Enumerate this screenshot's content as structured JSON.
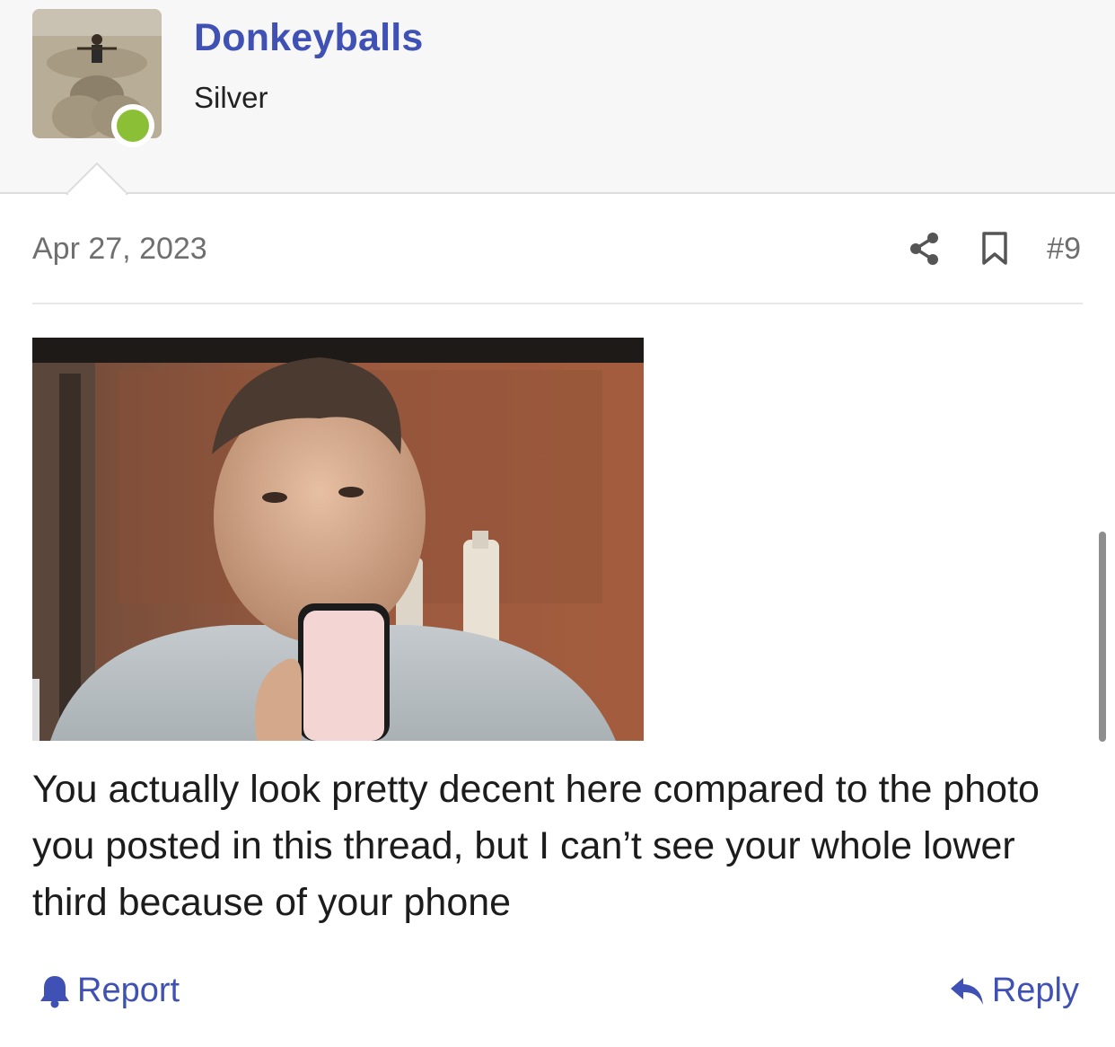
{
  "user": {
    "name": "Donkeyballs",
    "title": "Silver",
    "status": "online",
    "status_color": "#8bbf35"
  },
  "post": {
    "date": "Apr 27, 2023",
    "number": "#9",
    "body": "You actually look pretty decent here compared to the photo you posted in this thread, but I can’t see your whole lower third because of your phone"
  },
  "actions": {
    "share_icon": "share-icon",
    "bookmark_icon": "bookmark-icon",
    "report_label": "Report",
    "report_icon": "bell-icon",
    "reply_label": "Reply",
    "reply_icon": "reply-arrow-icon"
  },
  "colors": {
    "accent": "#3f51b5",
    "muted_text": "#6f6f6f",
    "header_bg": "#f7f7f7"
  }
}
